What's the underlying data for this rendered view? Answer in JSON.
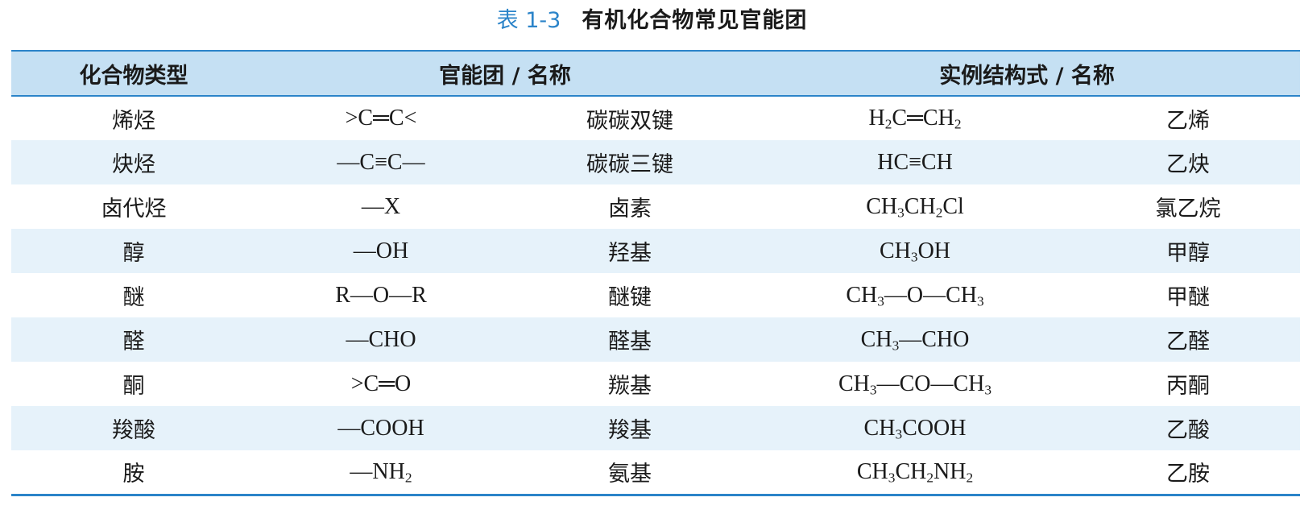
{
  "caption": {
    "number": "表 1-3",
    "title": "有机化合物常见官能团"
  },
  "table": {
    "headers": {
      "compound_type": "化合物类型",
      "functional_group": "官能团 / 名称",
      "example": "实例结构式 / 名称"
    },
    "rows": [
      {
        "type": "烯烃",
        "group": ">C═C<",
        "group_name": "碳碳双键",
        "example": "H₂C═CH₂",
        "example_name": "乙烯"
      },
      {
        "type": "炔烃",
        "group": "—C≡C—",
        "group_name": "碳碳三键",
        "example": "HC≡CH",
        "example_name": "乙炔"
      },
      {
        "type": "卤代烃",
        "group": "—X",
        "group_name": "卤素",
        "example": "CH₃CH₂Cl",
        "example_name": "氯乙烷"
      },
      {
        "type": "醇",
        "group": "—OH",
        "group_name": "羟基",
        "example": "CH₃OH",
        "example_name": "甲醇"
      },
      {
        "type": "醚",
        "group": "R—O—R",
        "group_name": "醚键",
        "example": "CH₃—O—CH₃",
        "example_name": "甲醚"
      },
      {
        "type": "醛",
        "group": "—CHO",
        "group_name": "醛基",
        "example": "CH₃—CHO",
        "example_name": "乙醛"
      },
      {
        "type": "酮",
        "group": ">C═O",
        "group_name": "羰基",
        "example": "CH₃—CO—CH₃",
        "example_name": "丙酮"
      },
      {
        "type": "羧酸",
        "group": "—COOH",
        "group_name": "羧基",
        "example": "CH₃COOH",
        "example_name": "乙酸"
      },
      {
        "type": "胺",
        "group": "—NH₂",
        "group_name": "氨基",
        "example": "CH₃CH₂NH₂",
        "example_name": "乙胺"
      }
    ]
  },
  "colors": {
    "accent": "#2b84c9",
    "header_bg": "#c5e0f3",
    "alt_row_bg": "#e6f2fa"
  }
}
